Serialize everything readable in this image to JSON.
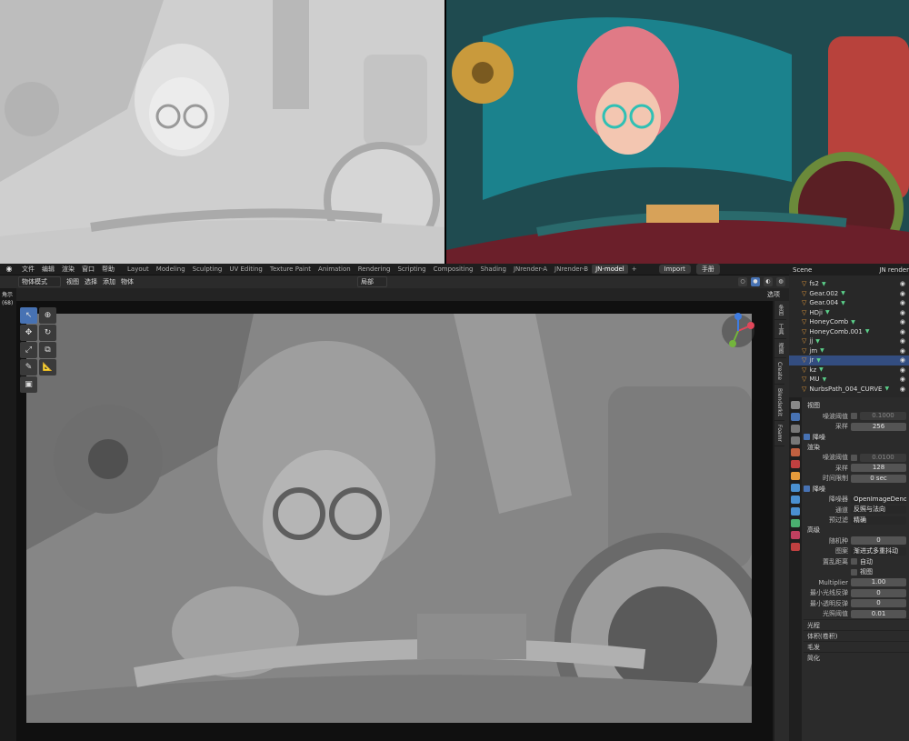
{
  "menubar": {
    "menus": [
      "文件",
      "编辑",
      "渲染",
      "窗口",
      "帮助"
    ],
    "workspaces": [
      "Layout",
      "Modeling",
      "Sculpting",
      "UV Editing",
      "Texture Paint",
      "Animation",
      "Rendering",
      "Scripting",
      "Compositing",
      "Shading",
      "JNrender-A",
      "JNrender-B",
      "JN-model"
    ],
    "active_workspace": "JN-model",
    "add_tab": "+",
    "import_label": "Import",
    "hand_label": "手册",
    "scene_label": "Scene",
    "render_layer": "JN render"
  },
  "header": {
    "mode": "物体模式",
    "menus": [
      "视图",
      "选择",
      "添加",
      "物体"
    ],
    "pivot": "局部",
    "options": "选项"
  },
  "left_edge": {
    "label_top": "角示",
    "label_count": "(68)"
  },
  "sidetabs": [
    "条目",
    "工具",
    "视图",
    "Create",
    "Blenderkit",
    "Foamr"
  ],
  "outliner": {
    "rows": [
      {
        "name": "fs2",
        "selected": false
      },
      {
        "name": "Gear.002",
        "selected": false
      },
      {
        "name": "Gear.004",
        "selected": false
      },
      {
        "name": "HDji",
        "selected": false
      },
      {
        "name": "HoneyComb",
        "selected": false
      },
      {
        "name": "HoneyComb.001",
        "selected": false
      },
      {
        "name": "jj",
        "selected": false
      },
      {
        "name": "jm",
        "selected": false
      },
      {
        "name": "jr",
        "selected": true
      },
      {
        "name": "kz",
        "selected": false
      },
      {
        "name": "MU",
        "selected": false
      },
      {
        "name": "NurbsPath_004_CURVE",
        "selected": false
      }
    ]
  },
  "properties": {
    "viewport_section": "视图",
    "noise_threshold_label": "噪波阈值",
    "noise_threshold_value": "0.1000",
    "samples_label": "采样",
    "samples_viewport": "256",
    "denoise_label": "降噪",
    "render_section": "渲染",
    "render_noise_threshold": "0.0100",
    "render_samples": "128",
    "time_limit_label": "时间限制",
    "time_limit_value": "0 sec",
    "denoiser_label": "降噪器",
    "denoiser_value": "OpenImageDenoise",
    "passes_label": "通道",
    "passes_value": "反照与法向",
    "prefilter_label": "预过滤",
    "prefilter_value": "精确",
    "advanced_section": "高级",
    "seed_label": "随机种",
    "seed_value": "0",
    "pattern_label": "图案",
    "pattern_value": "渐进式多重抖动",
    "scramble_label": "置乱距离",
    "auto_label": "自动",
    "viewport_cb_label": "视图",
    "multiplier_label": "Multiplier",
    "multiplier_value": "1.00",
    "min_light_label": "最小光线反弹",
    "min_light_value": "0",
    "min_transp_label": "最小透明反弹",
    "min_transp_value": "0",
    "light_thresh_label": "光照阈值",
    "light_thresh_value": "0.01",
    "collapsed": [
      "光程",
      "体积(卷积)",
      "毛发",
      "简化"
    ]
  },
  "colors": {
    "accent": "#4772b3",
    "selected_row": "#334d80",
    "panel": "#2b2b2b",
    "clay": "#8c8c8c"
  }
}
